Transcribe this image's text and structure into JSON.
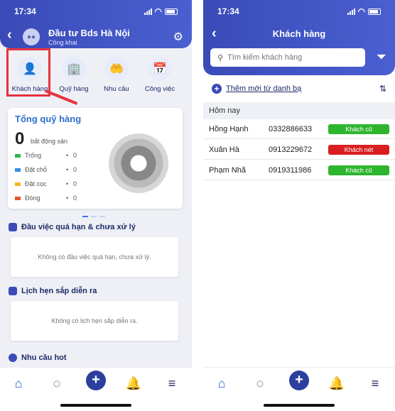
{
  "left": {
    "status_time": "17:34",
    "header": {
      "title": "Đầu tư Bds Hà Nội",
      "subtitle": "Công khai"
    },
    "quick_actions": [
      {
        "label": "Khách hàng",
        "icon": "customer-icon"
      },
      {
        "label": "Quỹ hàng",
        "icon": "building-icon"
      },
      {
        "label": "Nhu cầu",
        "icon": "hand-heart-icon"
      },
      {
        "label": "Công việc",
        "icon": "calendar-icon"
      }
    ],
    "summary": {
      "title": "Tổng quỹ hàng",
      "count": "0",
      "count_label": "bất động sản",
      "legend": [
        {
          "name": "Trống",
          "value": "0",
          "color": "#2db84a"
        },
        {
          "name": "Đặt chỗ",
          "value": "0",
          "color": "#2f8ee0"
        },
        {
          "name": "Đặt cọc",
          "value": "0",
          "color": "#f2b81d"
        },
        {
          "name": "Đóng",
          "value": "0",
          "color": "#e6542b"
        }
      ]
    },
    "sections": {
      "overdue": {
        "title": "Đầu việc quá hạn & chưa xử lý",
        "empty": "Không có đầu việc quá hạn, chưa xử lý."
      },
      "appointments": {
        "title": "Lịch hẹn sắp diễn ra",
        "empty": "Không có lịch hẹn sắp diễn ra."
      },
      "hot": {
        "title": "Nhu cầu hot"
      }
    }
  },
  "right": {
    "status_time": "17:34",
    "title": "Khách hàng",
    "search_placeholder": "Tìm kiếm khách hàng",
    "add_label": "Thêm mới từ danh bạ",
    "group_label": "Hôm nay",
    "customers": [
      {
        "name": "Hồng Hạnh",
        "phone": "0332886633",
        "tag": "Khách cũ",
        "tag_color": "#2db52d"
      },
      {
        "name": "Xuân Hà",
        "phone": "0913229672",
        "tag": "Khách nét",
        "tag_color": "#d91f1f"
      },
      {
        "name": "Phạm Nhã",
        "phone": "0919311986",
        "tag": "Khách cũ",
        "tag_color": "#2db52d"
      }
    ]
  }
}
